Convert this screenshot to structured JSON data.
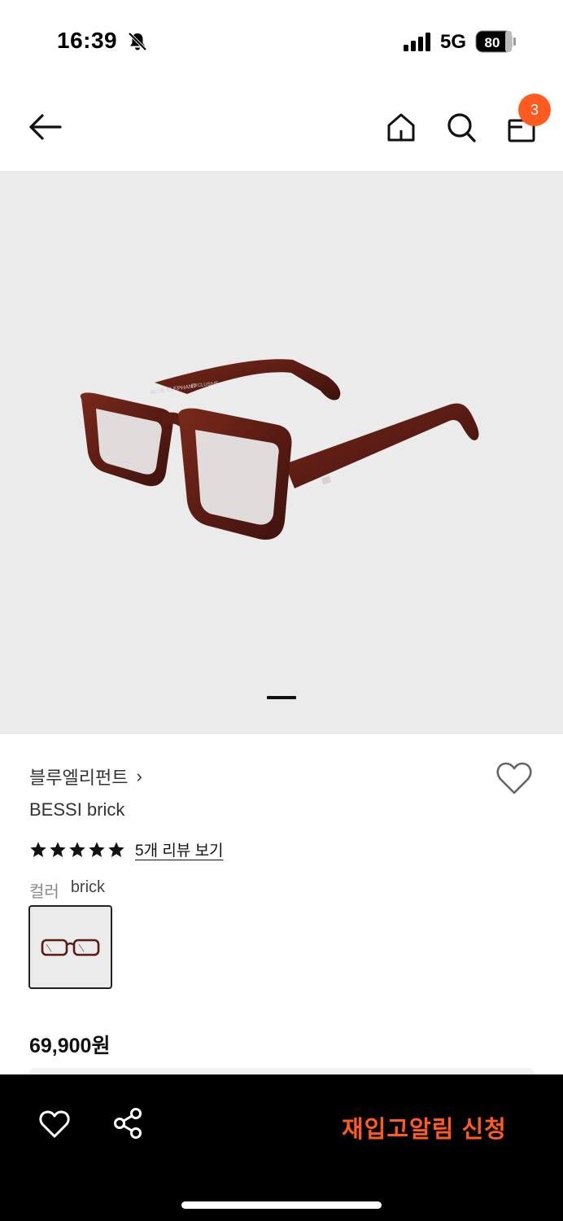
{
  "status_bar": {
    "time": "16:39",
    "network": "5G",
    "battery_level": "80",
    "icons": [
      "bell-slash-icon",
      "signal-icon",
      "battery-icon"
    ]
  },
  "topnav": {
    "icons": [
      "arrow-left-icon",
      "home-icon",
      "search-icon",
      "shopping-bag-icon"
    ],
    "cart_count": "3"
  },
  "hero": {
    "image": "eyeglasses-photo",
    "temple_text_1": "BLUE ELEPHANT",
    "temple_text_2": "EXCLUSIVE",
    "active_slide": 1
  },
  "product": {
    "brand": "블루엘리펀트",
    "brand_chevron": "›",
    "name": "BESSI brick",
    "rating_stars": 5,
    "review_link": "5개 리뷰 보기",
    "color_label": "컬러",
    "color_value": "brick",
    "price": "69,900원"
  },
  "bottom_bar": {
    "icons": [
      "heart-outline-icon",
      "share-icon"
    ],
    "cta_label": "재입고알림 신청"
  },
  "colors": {
    "accent": "#ff5a1f",
    "hero_bg": "#ebebeb",
    "bottom_bar_bg": "#000000",
    "frame_color": "#5a1c14"
  }
}
